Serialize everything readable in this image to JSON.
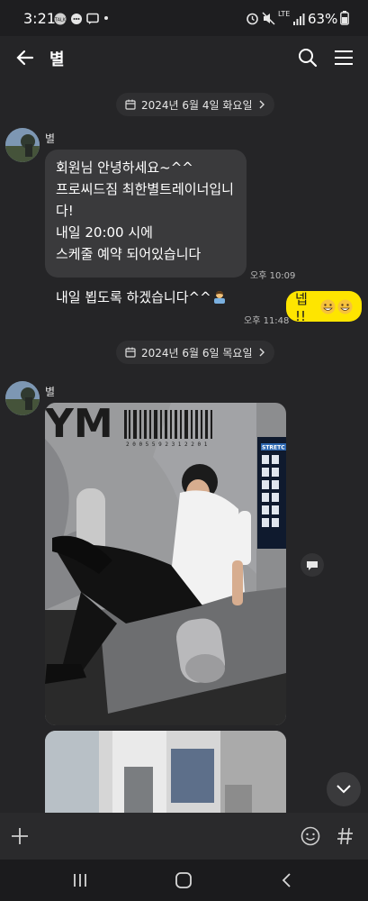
{
  "status_bar": {
    "time": "3:21",
    "network": "LTE",
    "battery": "63%"
  },
  "header": {
    "title": "별",
    "back_icon": "arrow-left-icon",
    "search_icon": "search-icon",
    "menu_icon": "hamburger-menu-icon"
  },
  "messages": {
    "date1": "2024년 6월 4일 화요일",
    "sender1": "별",
    "bubble1_lines": "회원님 안녕하세요~^^\n프로씨드짐 최한별트레이너입니다!\n내일 20:00 시에\n스케줄 예약 되어있습니다\n\n내일 뵙도록 하겠습니다^^",
    "time1": "오후 10:09",
    "reply_text": "넵 !!",
    "reply_emoji": "😄😄",
    "time2": "오후 11:48",
    "date2": "2024년 6월 6일 목요일",
    "sender2": "별",
    "gym_sign": "2 0 0 5 5 9 2 3 1 2 2 0 1",
    "poster_title": "STRETC"
  },
  "colors": {
    "background": "#252527",
    "bubble_in": "#3a3a3c",
    "bubble_out": "#fee500"
  }
}
